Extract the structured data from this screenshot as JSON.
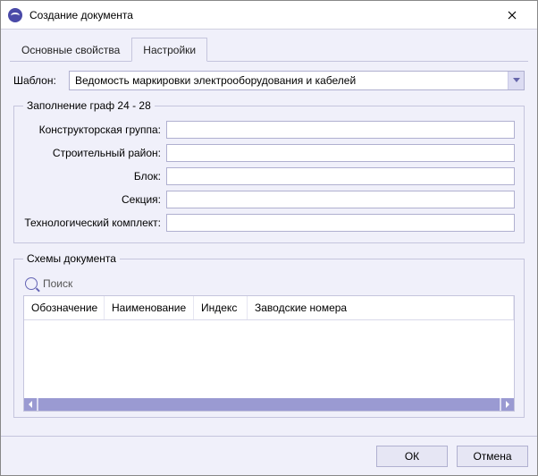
{
  "window": {
    "title": "Создание документа"
  },
  "tabs": {
    "main": "Основные свойства",
    "settings": "Настройки",
    "active": "settings"
  },
  "template": {
    "label": "Шаблон:",
    "value": "Ведомость маркировки электрооборудования и кабелей"
  },
  "group_fill": {
    "legend": "Заполнение граф 24 - 28",
    "fields": {
      "designer_group": {
        "label": "Конструкторская группа:",
        "value": ""
      },
      "build_region": {
        "label": "Строительный район:",
        "value": ""
      },
      "block": {
        "label": "Блок:",
        "value": ""
      },
      "section": {
        "label": "Секция:",
        "value": ""
      },
      "tech_kit": {
        "label": "Технологический комплект:",
        "value": ""
      }
    }
  },
  "schemas": {
    "legend": "Схемы документа",
    "search_placeholder": "Поиск",
    "columns": [
      "Обозначение",
      "Наименование",
      "Индекс",
      "Заводские номера"
    ],
    "rows": []
  },
  "footer": {
    "ok": "ОК",
    "cancel": "Отмена"
  }
}
